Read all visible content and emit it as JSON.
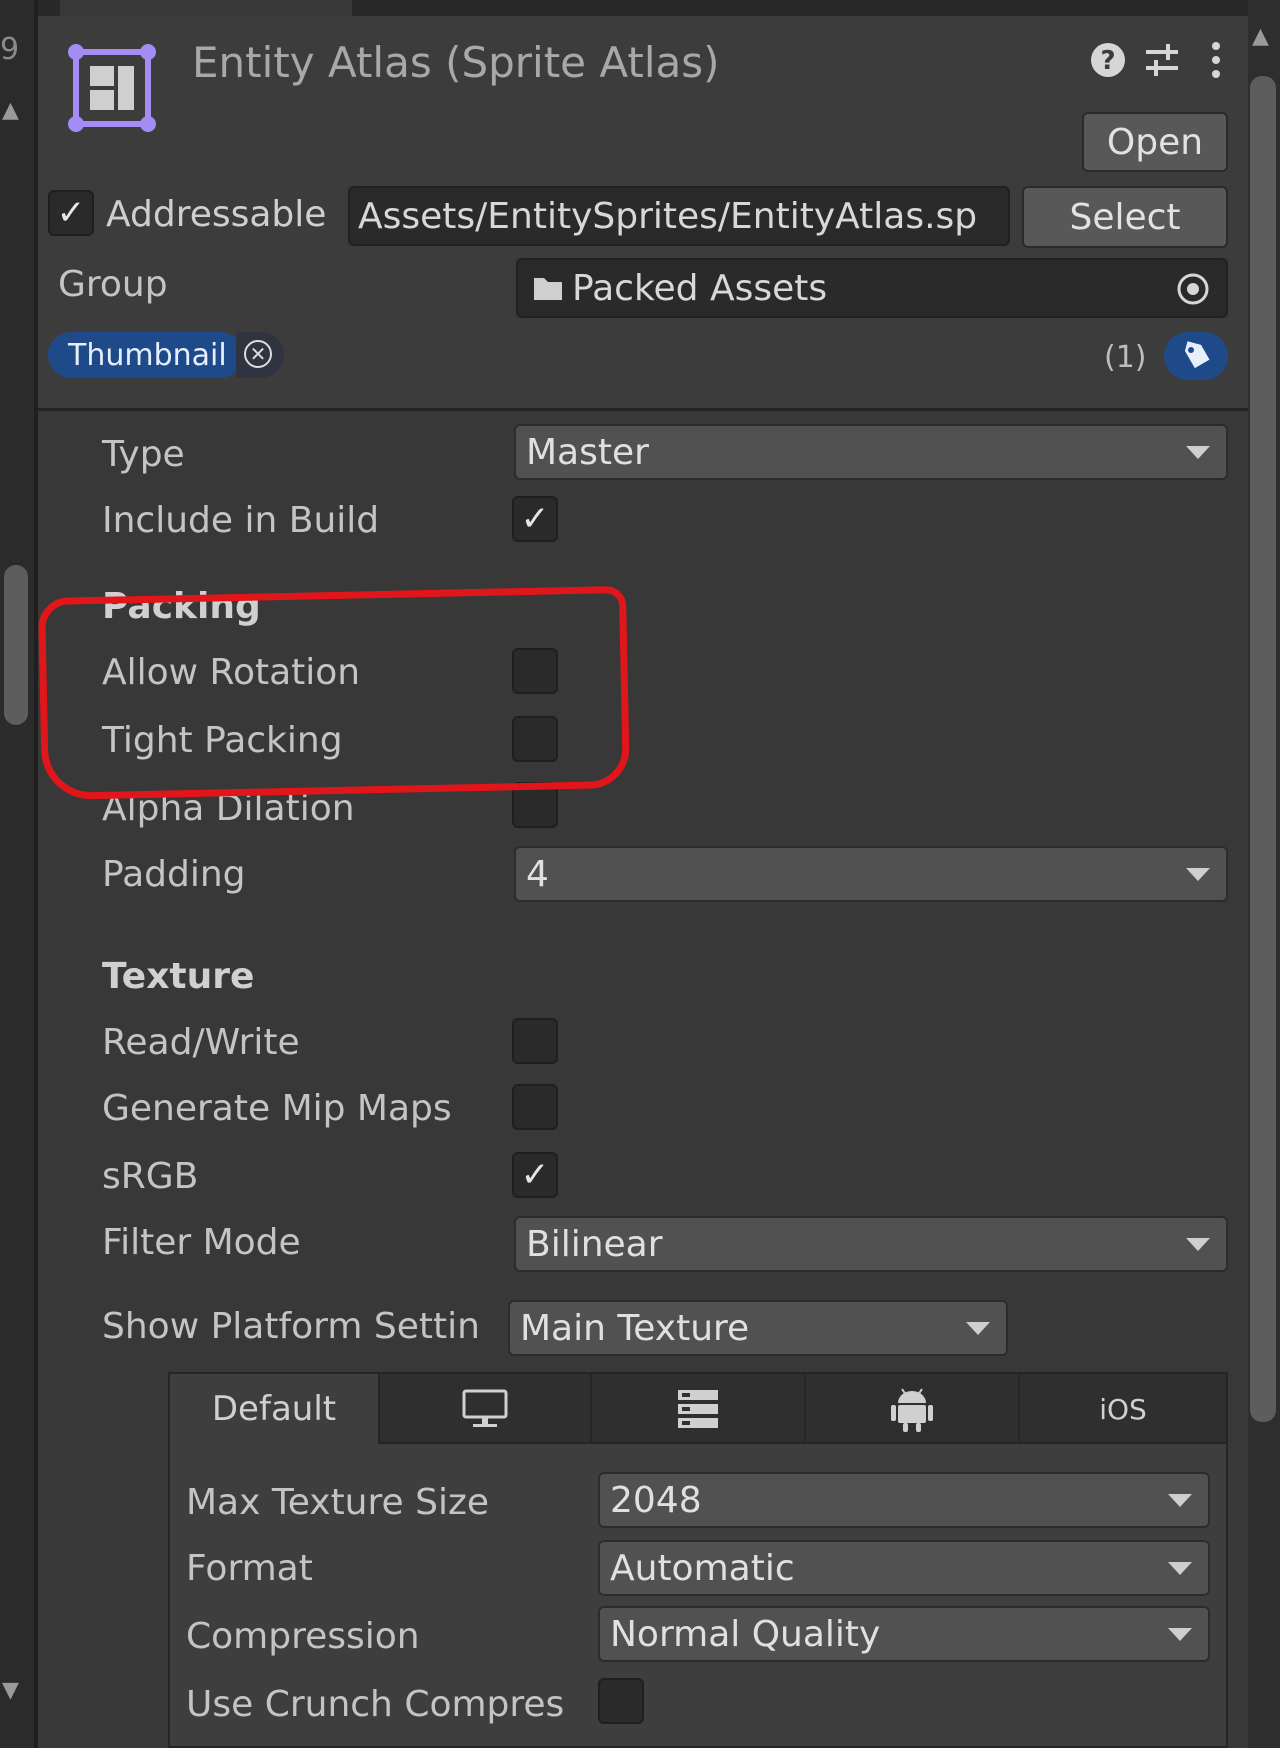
{
  "header": {
    "title": "Entity Atlas (Sprite Atlas)",
    "open_label": "Open",
    "help_icon": "help-icon",
    "settings_icon": "sliders-icon",
    "menu_icon": "kebab-menu-icon"
  },
  "addressable": {
    "checked": "✓",
    "label": "Addressable",
    "path": "Assets/EntitySprites/EntityAtlas.sp",
    "select_label": "Select"
  },
  "group": {
    "label": "Group",
    "value": "Packed Assets"
  },
  "tags": {
    "label": "Thumbnail",
    "count": "(1)"
  },
  "properties": {
    "type_label": "Type",
    "type_value": "Master",
    "include_label": "Include in Build",
    "include_check": "✓"
  },
  "packing": {
    "heading": "Packing",
    "allow_rotation": "Allow Rotation",
    "tight_packing": "Tight Packing",
    "alpha_dilation": "Alpha Dilation",
    "padding_label": "Padding",
    "padding_value": "4"
  },
  "texture": {
    "heading": "Texture",
    "read_write": "Read/Write",
    "mip_maps": "Generate Mip Maps",
    "srgb": "sRGB",
    "srgb_check": "✓",
    "filter_label": "Filter Mode",
    "filter_value": "Bilinear",
    "platform_label": "Show Platform Settin",
    "platform_value": "Main Texture"
  },
  "platform_tabs": {
    "default": "Default",
    "ios": "iOS"
  },
  "platform_settings": {
    "max_size_label": "Max Texture Size",
    "max_size_value": "2048",
    "format_label": "Format",
    "format_value": "Automatic",
    "compression_label": "Compression",
    "compression_value": "Normal Quality",
    "crunch_label": "Use Crunch Compres"
  },
  "colors": {
    "background": "#383838",
    "accent_tag": "#1e4a8a",
    "annotation": "#e0161b",
    "atlas_icon": "#a58cf5"
  }
}
